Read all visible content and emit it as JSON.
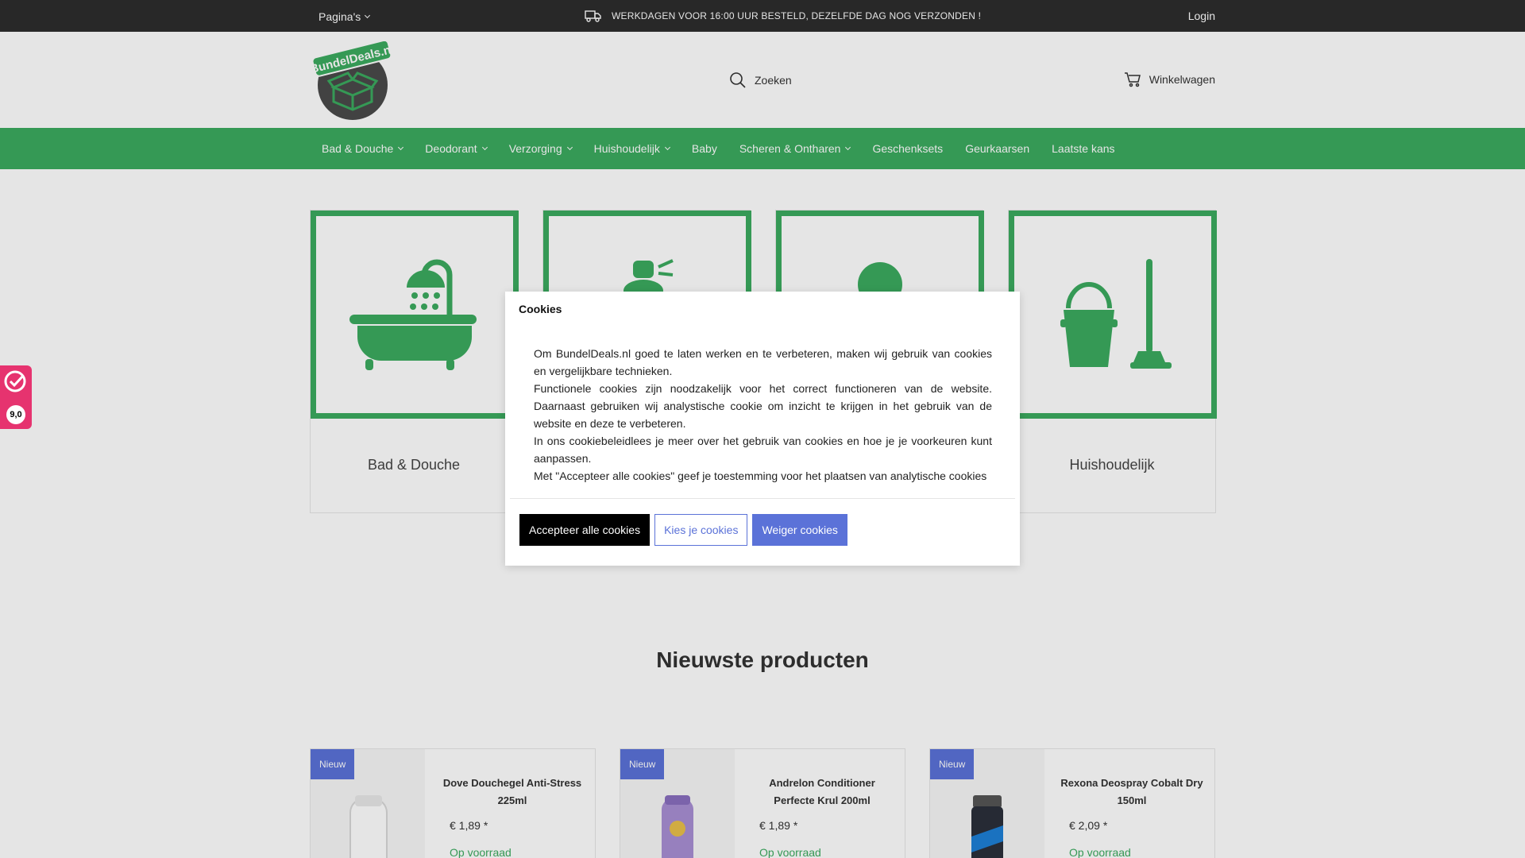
{
  "topbar": {
    "pages_label": "Pagina's",
    "notice": "WERKDAGEN VOOR 16:00 UUR BESTELD, DEZELFDE DAG NOG VERZONDEN !",
    "login": "Login"
  },
  "header": {
    "logo_text": "BundelDeals.nl",
    "search_label": "Zoeken",
    "cart_label": "Winkelwagen"
  },
  "nav": [
    {
      "label": "Bad & Douche",
      "dropdown": true
    },
    {
      "label": "Deodorant",
      "dropdown": true
    },
    {
      "label": "Verzorging",
      "dropdown": true
    },
    {
      "label": "Huishoudelijk",
      "dropdown": true
    },
    {
      "label": "Baby",
      "dropdown": false
    },
    {
      "label": "Scheren & Ontharen",
      "dropdown": true
    },
    {
      "label": "Geschenksets",
      "dropdown": false
    },
    {
      "label": "Geurkaarsen",
      "dropdown": false
    },
    {
      "label": "Laatste kans",
      "dropdown": false
    }
  ],
  "categories": [
    {
      "label": "Bad & Douche",
      "icon": "bathtub-icon"
    },
    {
      "label": "",
      "icon": "deodorant-icon"
    },
    {
      "label": "",
      "icon": "person-icon"
    },
    {
      "label": "Huishoudelijk",
      "icon": "bucket-mop-icon"
    }
  ],
  "section_title": "Nieuwste producten",
  "products": [
    {
      "badge": "Nieuw",
      "title": "Dove Douchegel Anti-Stress 225ml",
      "price": "€ 1,89 *",
      "stock": "Op voorraad"
    },
    {
      "badge": "Nieuw",
      "title": "Andrelon Conditioner Perfecte Krul 200ml",
      "price": "€ 1,89 *",
      "stock": "Op voorraad"
    },
    {
      "badge": "Nieuw",
      "title": "Rexona Deospray Cobalt Dry 150ml",
      "price": "€ 2,09 *",
      "stock": "Op voorraad"
    }
  ],
  "cookie": {
    "title": "Cookies",
    "paragraphs": [
      "Om BundelDeals.nl goed te laten werken en te verbeteren, maken wij gebruik van cookies en vergelijkbare technieken.",
      "Functionele cookies zijn noodzakelijk voor het correct functioneren van de website. Daarnaast gebruiken wij analystische cookie om inzicht te krijgen in het gebruik van de website en deze te verbeteren.",
      "In ons cookiebeleidlees je meer over het gebruik van cookies en hoe je je voorkeuren kunt aanpassen.",
      "Met \"Accepteer alle cookies\" geef je toestemming voor het plaatsen van analytische cookies"
    ],
    "accept": "Accepteer alle cookies",
    "choose": "Kies je cookies",
    "refuse": "Weiger cookies"
  },
  "review": {
    "score": "9,0"
  },
  "colors": {
    "brand_green": "#3cab5f",
    "topbar": "#2d2d2d",
    "accent_blue": "#5b72d8",
    "review_pink": "#e6336f"
  }
}
